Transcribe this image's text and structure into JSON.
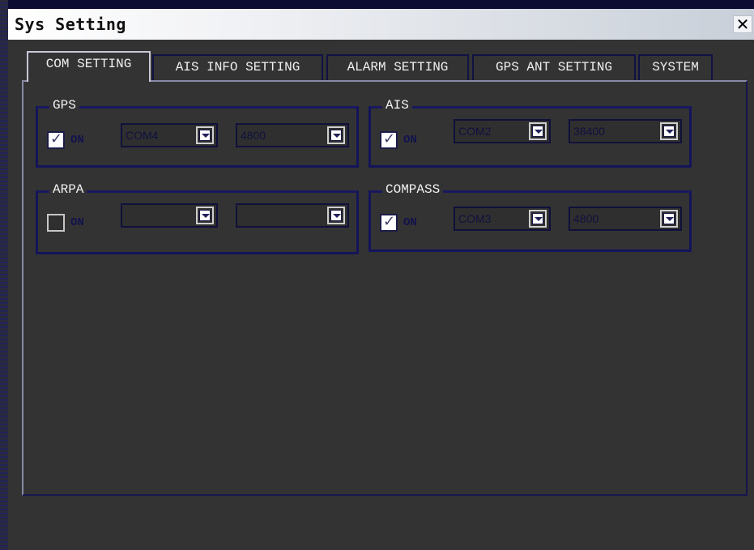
{
  "window": {
    "title": "Sys Setting",
    "close_glyph": "✕"
  },
  "tabs": [
    {
      "label": "COM SETTING",
      "active": true
    },
    {
      "label": "AIS INFO SETTING",
      "active": false
    },
    {
      "label": "ALARM SETTING",
      "active": false
    },
    {
      "label": "GPS ANT SETTING",
      "active": false
    },
    {
      "label": "SYSTEM",
      "active": false
    }
  ],
  "groups": {
    "gps": {
      "label": "GPS",
      "on_label": "ON",
      "checked": true,
      "port": "COM4",
      "baud": "4800"
    },
    "ais": {
      "label": "AIS",
      "on_label": "ON",
      "checked": true,
      "port": "COM2",
      "baud": "38400"
    },
    "arpa": {
      "label": "ARPA",
      "on_label": "ON",
      "checked": false,
      "port": "",
      "baud": ""
    },
    "compass": {
      "label": "COMPASS",
      "on_label": "ON",
      "checked": true,
      "port": "COM3",
      "baud": "4800"
    }
  }
}
